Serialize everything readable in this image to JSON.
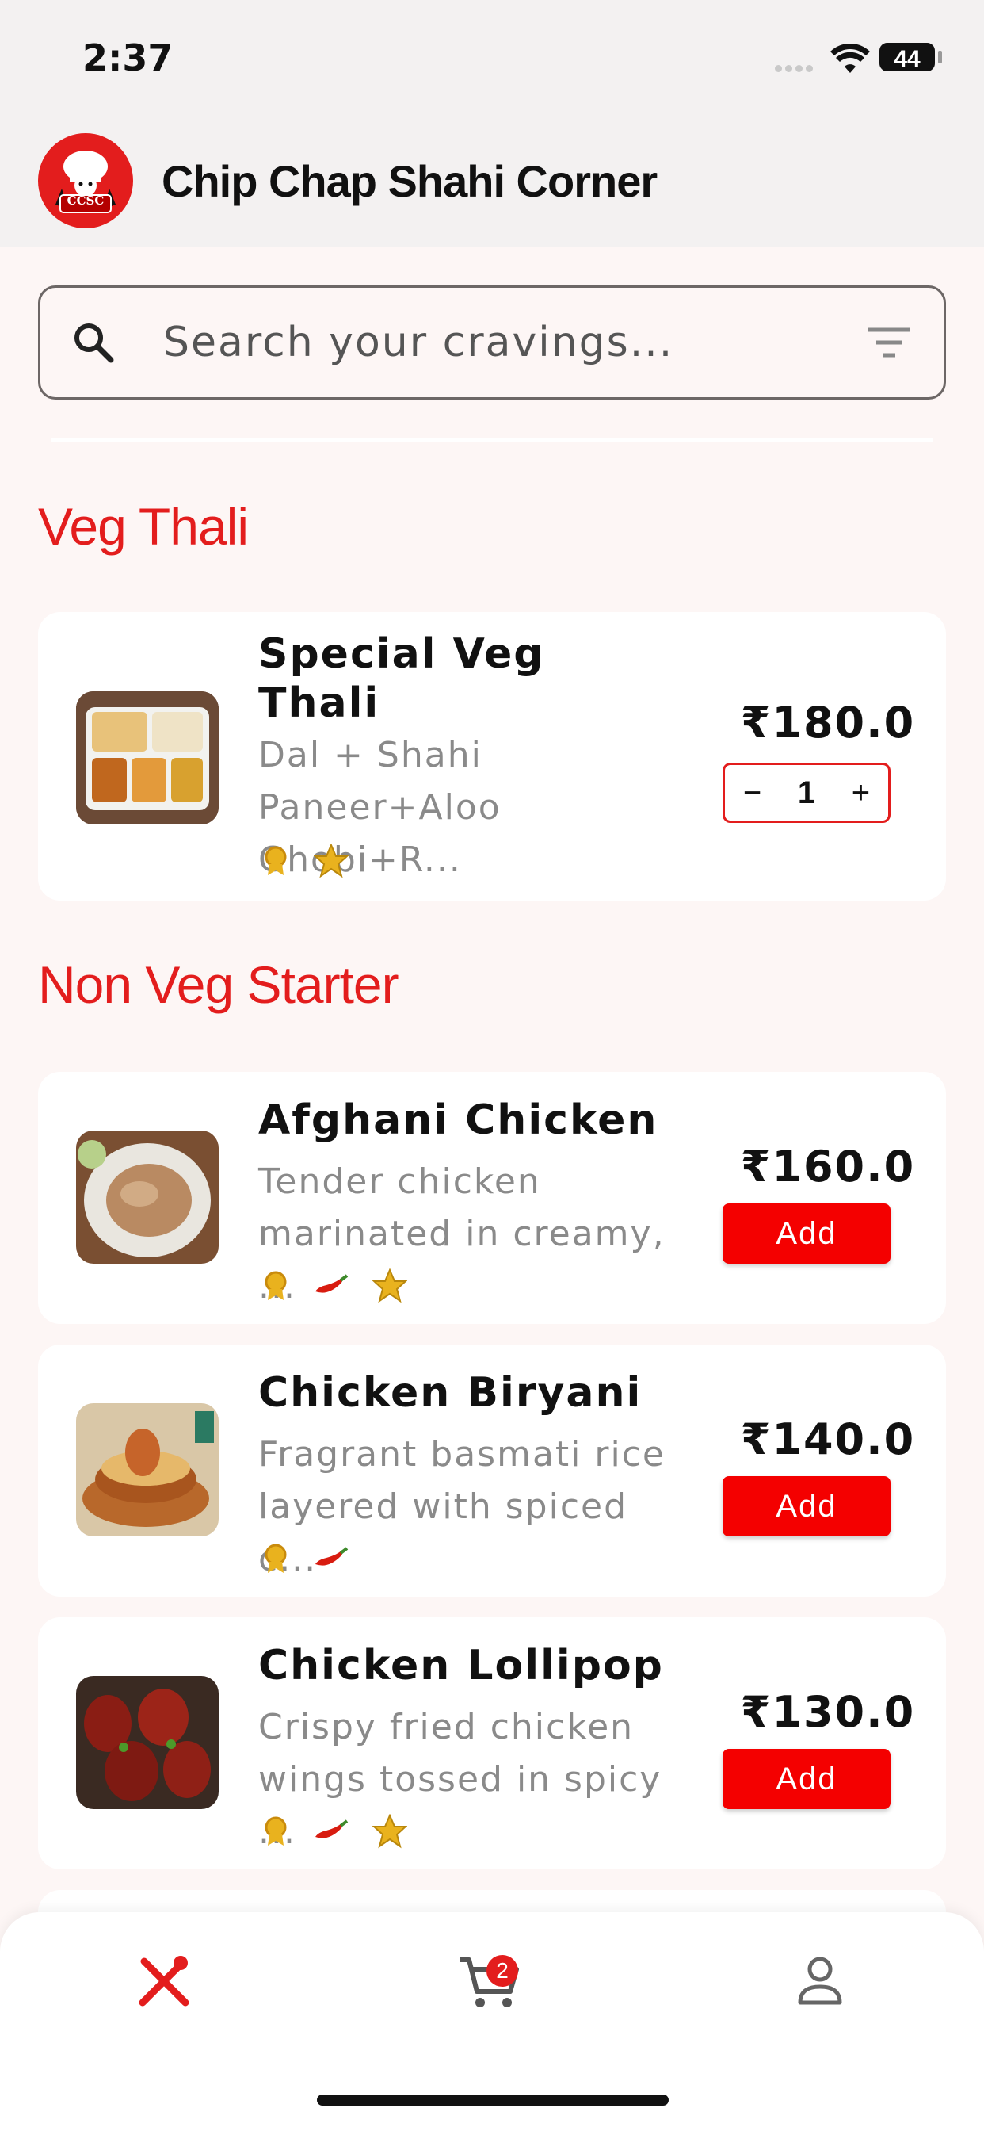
{
  "status": {
    "time": "2:37",
    "battery": "44"
  },
  "header": {
    "title": "Chip Chap Shahi Corner",
    "logo_text": "CCSC"
  },
  "search": {
    "placeholder": "Search your cravings..."
  },
  "sections": [
    {
      "title": "Veg Thali",
      "items": [
        {
          "name_line1": "Special Veg",
          "name_line2": "Thali",
          "desc_line1": "Dal + Shahi",
          "desc_line2": "Paneer+Aloo Ghobi+R...",
          "price": "₹180.0",
          "quantity": "1",
          "badges": [
            "award-icon",
            "star-icon"
          ]
        }
      ]
    },
    {
      "title": "Non Veg Starter",
      "items": [
        {
          "name": "Afghani Chicken",
          "desc_line1": "Tender chicken",
          "desc_line2": "marinated in creamy, ...",
          "price": "₹160.0",
          "add_label": "Add",
          "badges": [
            "award-icon",
            "chili-icon",
            "star-icon"
          ]
        },
        {
          "name": "Chicken Biryani",
          "desc_line1": "Fragrant basmati rice",
          "desc_line2": "layered with spiced c...",
          "price": "₹140.0",
          "add_label": "Add",
          "badges": [
            "award-icon",
            "chili-icon"
          ]
        },
        {
          "name": "Chicken Lollipop",
          "desc_line1": "Crispy fried chicken",
          "desc_line2": "wings tossed in spicy ...",
          "price": "₹130.0",
          "add_label": "Add",
          "badges": [
            "award-icon",
            "chili-icon",
            "star-icon"
          ]
        }
      ]
    }
  ],
  "bottom_nav": {
    "cart_count": "2",
    "icons": [
      "menu-icon",
      "cart-icon",
      "profile-icon"
    ]
  },
  "colors": {
    "accent": "#e31d1d",
    "button": "#f40000",
    "background": "#fdf6f5"
  }
}
